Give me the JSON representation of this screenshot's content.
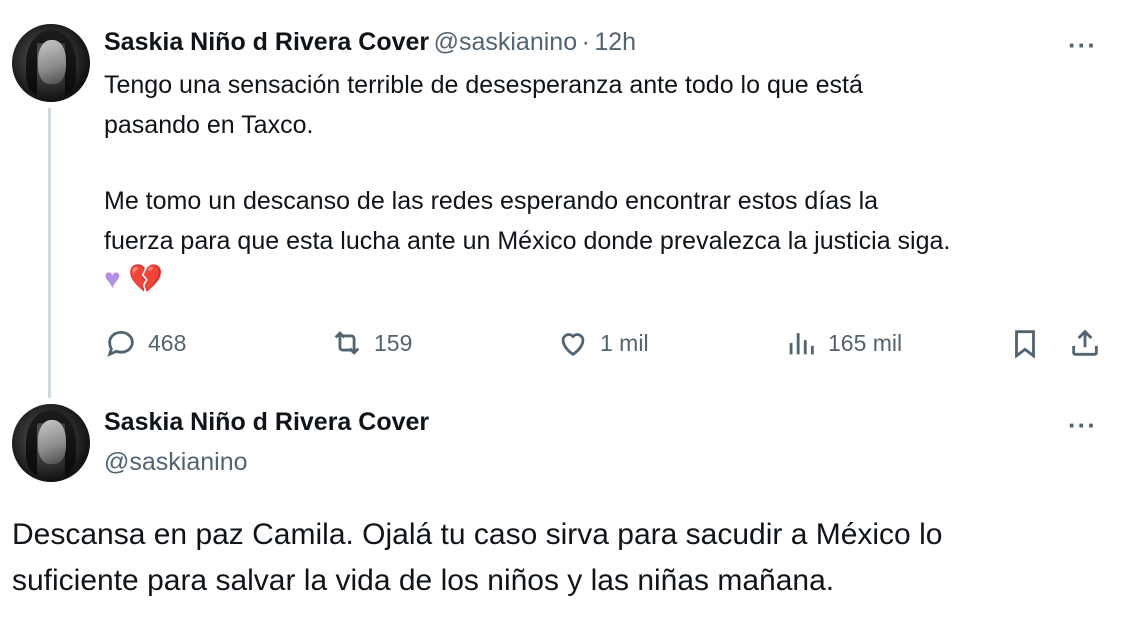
{
  "tweet1": {
    "author_name": "Saskia Niño d Rivera Cover",
    "handle": "@saskianino",
    "separator": "·",
    "time": "12h",
    "text_line1": "Tengo una sensación terrible de desesperanza ante todo lo que está",
    "text_line2": "pasando en Taxco.",
    "text_line3": "Me tomo un descanso de las redes esperando encontrar estos días la",
    "text_line4": "fuerza para que esta lucha ante un México donde prevalezca la justicia siga.",
    "emoji_1": "♥",
    "emoji_2": "💔",
    "replies": "468",
    "retweets": "159",
    "likes": "1 mil",
    "views": "165 mil",
    "more_label": "···"
  },
  "tweet2": {
    "author_name": "Saskia Niño d Rivera Cover",
    "handle": "@saskianino",
    "more_label": "···",
    "text_line1": "Descansa en paz Camila. Ojalá tu caso sirva para sacudir a México lo",
    "text_line2": "suficiente para salvar la vida de los niños y las niñas mañana."
  },
  "colors": {
    "text": "#0f1419",
    "muted": "#536471",
    "thread_line": "#cfd9de",
    "purple_heart": "#b48ee8",
    "broken_heart": "#e0334b"
  },
  "icons": [
    "reply-icon",
    "retweet-icon",
    "like-icon",
    "views-icon",
    "bookmark-icon",
    "share-icon",
    "more-icon"
  ]
}
